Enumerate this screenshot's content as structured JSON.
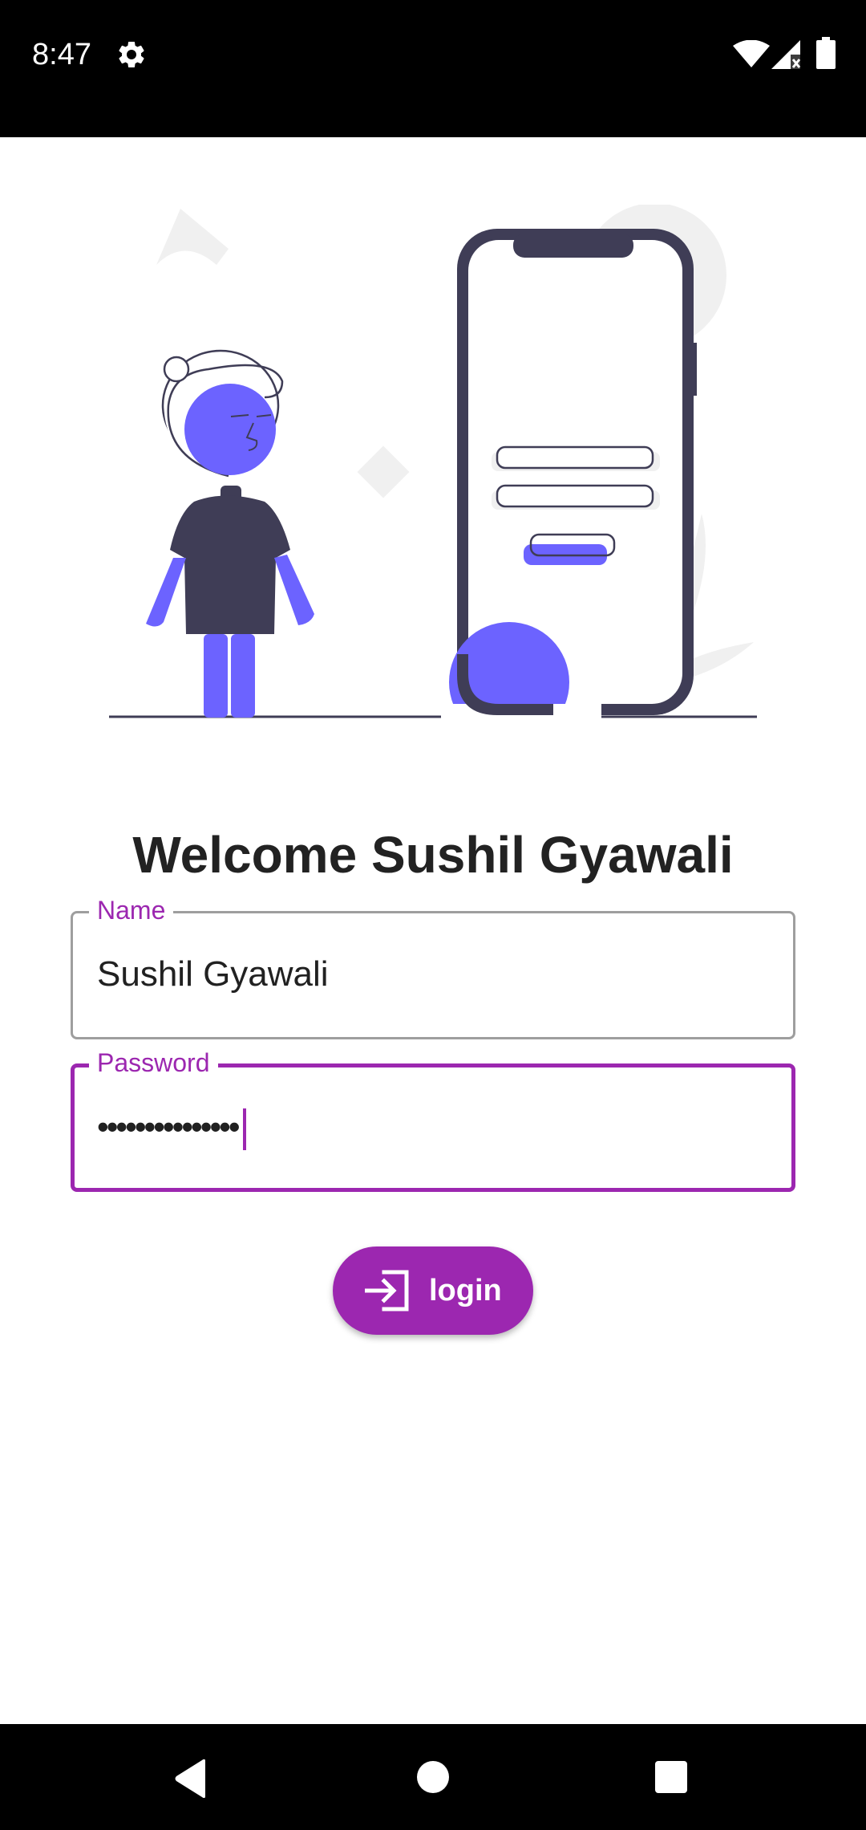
{
  "status_bar": {
    "time": "8:47",
    "icons": [
      "settings-icon",
      "wifi-icon",
      "cellular-signal-icon",
      "battery-icon"
    ]
  },
  "illustration": "login-illustration",
  "welcome": {
    "title": "Welcome Sushil Gyawali"
  },
  "form": {
    "name": {
      "label": "Name",
      "value": "Sushil Gyawali"
    },
    "password": {
      "label": "Password",
      "value": "•••••••••••••••",
      "focused": true
    }
  },
  "login_button": {
    "label": "login",
    "icon": "login-arrow-icon"
  },
  "nav_bar": {
    "icons": [
      "back-icon",
      "home-icon",
      "recents-icon"
    ]
  },
  "colors": {
    "accent": "#9c27b0",
    "illustration_primary": "#6c63ff",
    "illustration_dark": "#3f3d56",
    "illustration_light": "#f0f0f0",
    "text": "#222222"
  }
}
